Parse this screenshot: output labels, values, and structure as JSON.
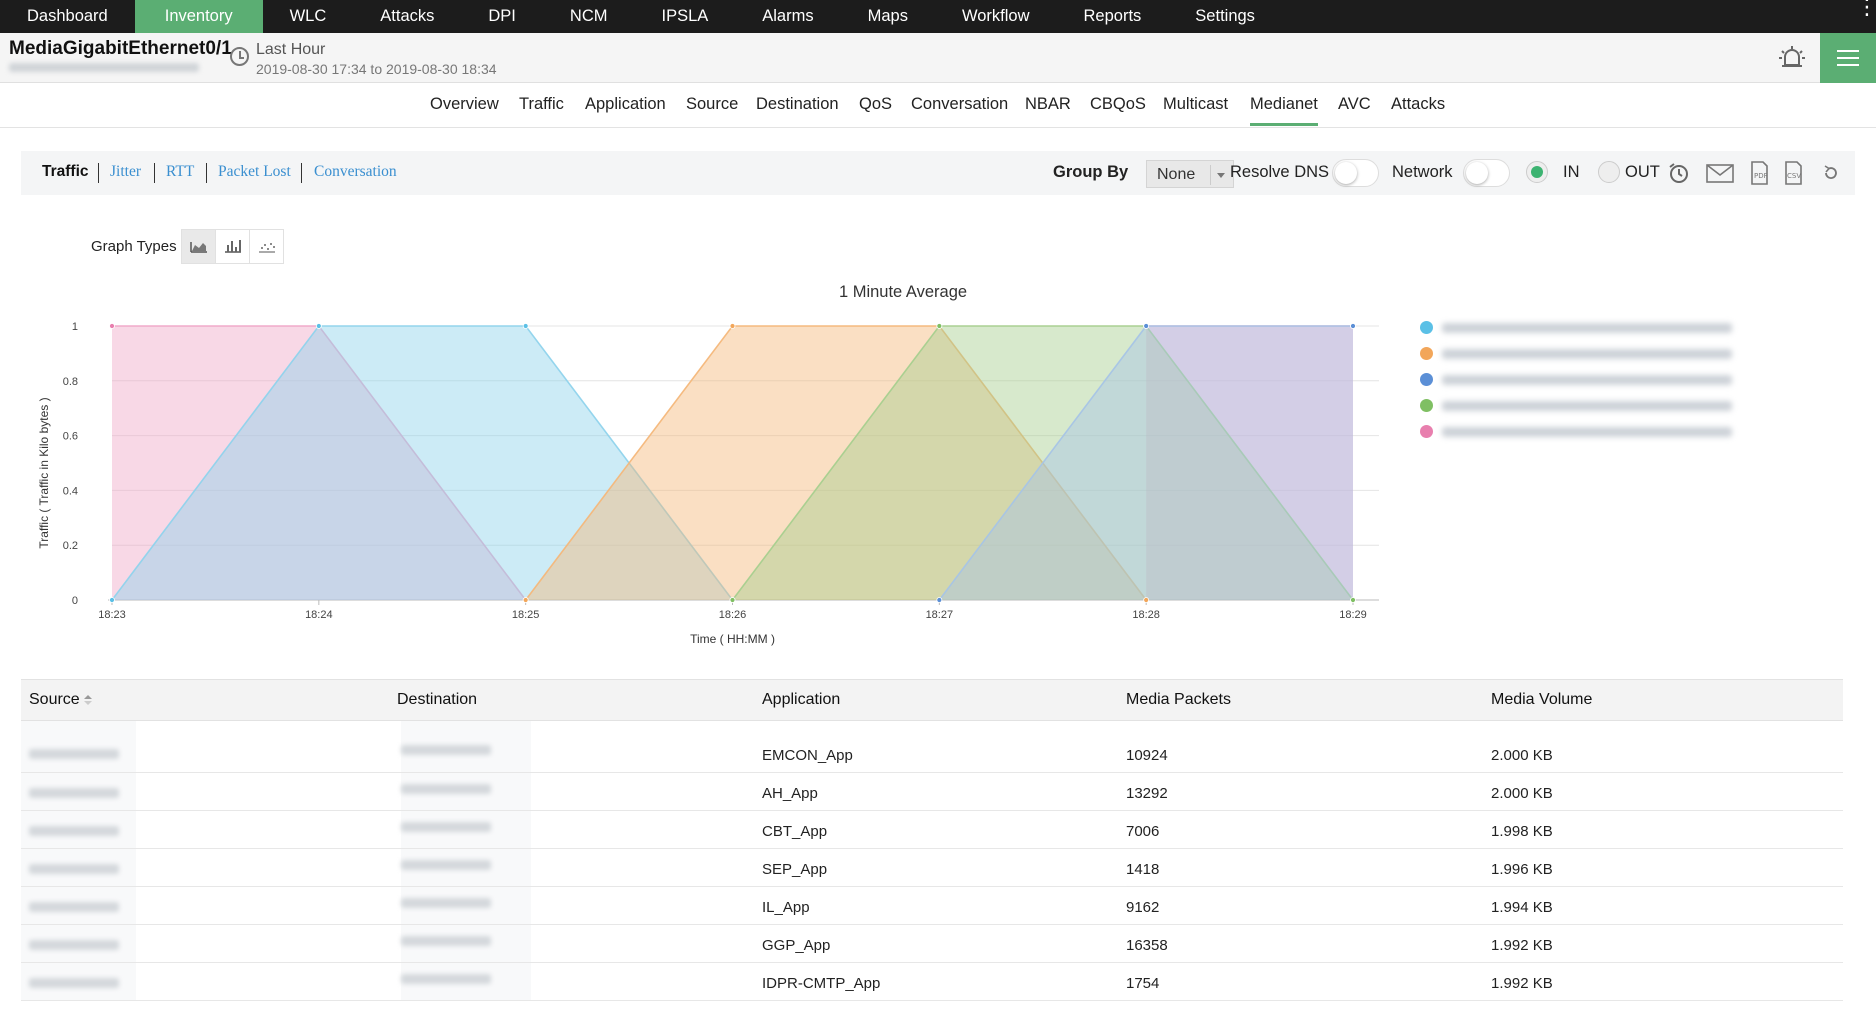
{
  "topnav": {
    "items": [
      "Dashboard",
      "Inventory",
      "WLC",
      "Attacks",
      "DPI",
      "NCM",
      "IPSLA",
      "Alarms",
      "Maps",
      "Workflow",
      "Reports",
      "Settings"
    ],
    "active": "Inventory"
  },
  "header": {
    "device_name": "MediaGigabitEthernet0/1",
    "range_title": "Last Hour",
    "range_dates": "2019-08-30 17:34 to 2019-08-30 18:34"
  },
  "subtabs": {
    "items": [
      "Overview",
      "Traffic",
      "Application",
      "Source",
      "Destination",
      "QoS",
      "Conversation",
      "NBAR",
      "CBQoS",
      "Multicast",
      "Medianet",
      "AVC",
      "Attacks"
    ],
    "active": "Medianet"
  },
  "toolbar": {
    "links": [
      "Traffic",
      "Jitter",
      "RTT",
      "Packet Lost",
      "Conversation"
    ],
    "active_link": "Traffic",
    "group_by_label": "Group By",
    "group_by_value": "None",
    "resolve_dns_label": "Resolve DNS",
    "network_label": "Network",
    "in_label": "IN",
    "out_label": "OUT",
    "direction_selected": "IN",
    "resolve_dns_on": false,
    "network_on": false
  },
  "graph_types": {
    "label": "Graph Types",
    "options": [
      "area-chart-icon",
      "bar-chart-icon",
      "scatter-chart-icon"
    ],
    "selected": "area-chart-icon"
  },
  "chart_data": {
    "type": "area",
    "title": "1 Minute Average",
    "xlabel": "Time ( HH:MM )",
    "ylabel": "Traffic ( Traffic in Kilo bytes )",
    "categories": [
      "18:23",
      "18:24",
      "18:25",
      "18:26",
      "18:27",
      "18:28",
      "18:29"
    ],
    "ylim": [
      0,
      1
    ],
    "yticks": [
      "0",
      "0.2",
      "0.4",
      "0.6",
      "0.8",
      "1"
    ],
    "grid": true,
    "legend": "right",
    "series": [
      {
        "color": "#f0a8c8",
        "values": [
          1,
          1,
          0,
          null,
          null,
          1,
          1
        ],
        "mask": [
          1,
          1,
          1,
          0,
          0,
          1,
          1
        ]
      },
      {
        "color": "#8fd3ec",
        "values": [
          0,
          1,
          1,
          0,
          null,
          null,
          null
        ],
        "mask": [
          1,
          1,
          1,
          1,
          0,
          0,
          0
        ]
      },
      {
        "color": "#f4b77a",
        "values": [
          null,
          null,
          0,
          1,
          1,
          0,
          null
        ],
        "mask": [
          0,
          0,
          1,
          1,
          1,
          1,
          0
        ]
      },
      {
        "color": "#a6cf8e",
        "values": [
          null,
          null,
          null,
          0,
          1,
          1,
          0
        ],
        "mask": [
          0,
          0,
          0,
          1,
          1,
          1,
          1
        ]
      },
      {
        "color": "#a6c4e6",
        "values": [
          null,
          null,
          null,
          null,
          0,
          1,
          1
        ],
        "mask": [
          0,
          0,
          0,
          0,
          1,
          1,
          1
        ]
      }
    ],
    "point_colors": [
      "#e87fae",
      "#5bc0e6",
      "#f2a65a",
      "#7fbf63",
      "#5b8fd6"
    ],
    "legend_colors": [
      "#5bc0e6",
      "#f2a65a",
      "#5b8fd6",
      "#7fbf63",
      "#e87fae"
    ]
  },
  "table": {
    "headers": [
      "Source",
      "Destination",
      "Application",
      "Media Packets",
      "Media Volume"
    ],
    "rows": [
      {
        "application": "EMCON_App",
        "packets": "10924",
        "volume": "2.000 KB"
      },
      {
        "application": "AH_App",
        "packets": "13292",
        "volume": "2.000 KB"
      },
      {
        "application": "CBT_App",
        "packets": "7006",
        "volume": "1.998 KB"
      },
      {
        "application": "SEP_App",
        "packets": "1418",
        "volume": "1.996 KB"
      },
      {
        "application": "IL_App",
        "packets": "9162",
        "volume": "1.994 KB"
      },
      {
        "application": "GGP_App",
        "packets": "16358",
        "volume": "1.992 KB"
      },
      {
        "application": "IDPR-CMTP_App",
        "packets": "1754",
        "volume": "1.992 KB"
      }
    ]
  },
  "colors": {
    "accent": "#5bae73",
    "nav_bg": "#1c1c1c",
    "link": "#3a8fd0"
  }
}
